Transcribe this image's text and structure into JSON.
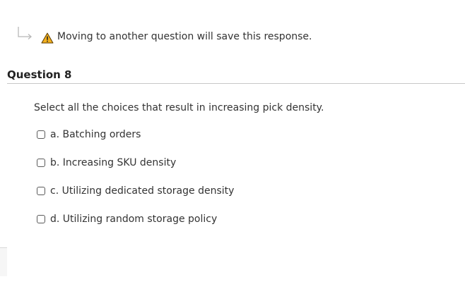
{
  "notice": {
    "text": "Moving to another question will save this response."
  },
  "question": {
    "title": "Question 8",
    "prompt": "Select all the choices that result in increasing pick density.",
    "choices": [
      {
        "label": "a. Batching orders",
        "checked": false
      },
      {
        "label": "b. Increasing SKU density",
        "checked": false
      },
      {
        "label": "c. Utilizing dedicated storage density",
        "checked": false
      },
      {
        "label": "d. Utilizing random storage policy",
        "checked": false
      }
    ]
  },
  "colors": {
    "warning_fill": "#f2b01e",
    "warning_mark": "#c0392b",
    "text": "#333333",
    "divider": "#c8c8c8"
  },
  "icons": {
    "arrow": "return-arrow-icon",
    "warning": "warning-icon"
  }
}
